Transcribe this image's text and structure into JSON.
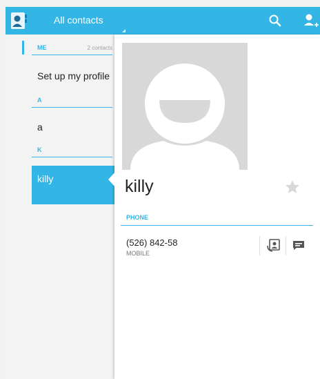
{
  "action_bar": {
    "title": "All contacts",
    "app_icon": "contacts-app-icon",
    "search_icon": "search-icon",
    "add_contact_icon": "add-person-icon",
    "color": "#33b5e5"
  },
  "list": {
    "me_header": {
      "label": "ME",
      "count": "2 contacts"
    },
    "setup_profile": "Set up my profile",
    "sections": [
      {
        "letter": "A",
        "contacts": [
          "a"
        ]
      },
      {
        "letter": "K",
        "contacts": [
          "killy"
        ]
      }
    ],
    "selected": "killy"
  },
  "detail": {
    "name": "killy",
    "favorite_icon": "star-icon",
    "phone_section": "PHONE",
    "phone": {
      "number": "(526) 842-58",
      "type": "MOBILE"
    },
    "actions": [
      "call-icon",
      "message-icon"
    ]
  }
}
